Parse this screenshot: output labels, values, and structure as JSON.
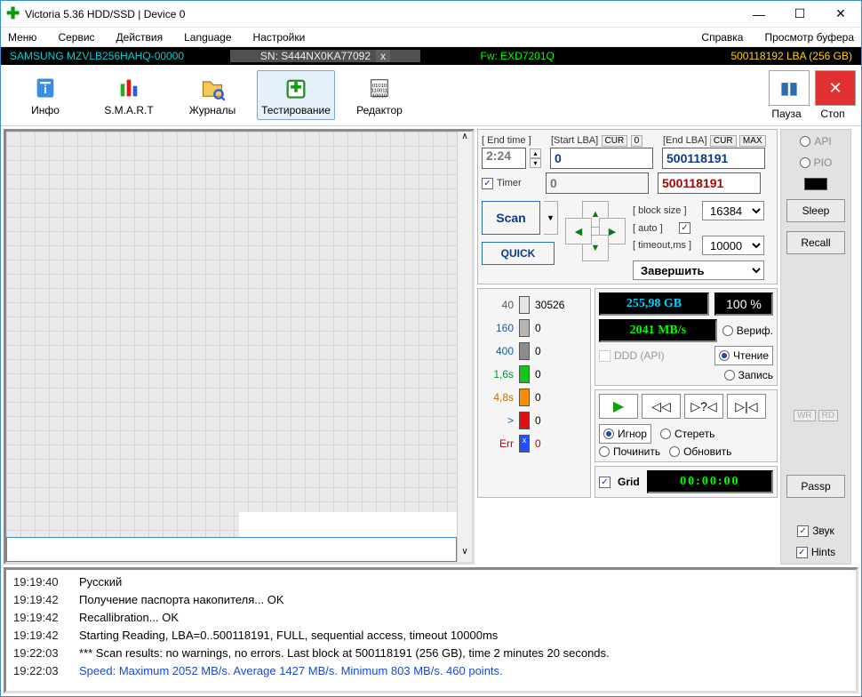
{
  "title": "Victoria 5.36 HDD/SSD | Device 0",
  "menu": {
    "m0": "Меню",
    "m1": "Сервис",
    "m2": "Действия",
    "m3": "Language",
    "m4": "Настройки",
    "m5": "Справка",
    "m6": "Просмотр буфера"
  },
  "device": {
    "model": "SAMSUNG MZVLB256HAHQ-00000",
    "sn": "SN: S444NX0KA77092",
    "fw": "Fw: EXD7201Q",
    "lba": "500118192 LBA (256 GB)"
  },
  "tools": {
    "info": "Инфо",
    "smart": "S.M.A.R.T",
    "journals": "Журналы",
    "test": "Тестирование",
    "editor": "Редактор",
    "pause": "Пауза",
    "stop": "Стоп"
  },
  "scan": {
    "endtime_lbl": "[ End time ]",
    "startlba_lbl": "[Start LBA]",
    "endlba_lbl": "[End LBA]",
    "cur": "CUR",
    "zero": "0",
    "max": "MAX",
    "endtime": "2:24",
    "startlba": "0",
    "endlba": "500118191",
    "timer_lbl": "Timer",
    "timer_start": "0",
    "timer_end": "500118191",
    "scan_btn": "Scan",
    "quick_btn": "QUICK",
    "blocksize_lbl": "[ block size ]",
    "auto_lbl": "[ auto ]",
    "timeout_lbl": "[ timeout,ms ]",
    "blocksize": "16384",
    "timeout": "10000",
    "finish_sel": "Завершить",
    "size_lcd": "255,98 GB",
    "speed_lcd": "2041 MB/s",
    "pct": "100   %",
    "verify": "Вериф.",
    "read": "Чтение",
    "write": "Запись",
    "ddd": "DDD (API)",
    "ignore": "Игнор",
    "erase": "Стереть",
    "repair": "Починить",
    "refresh": "Обновить",
    "grid": "Grid",
    "clock": "00:00:00"
  },
  "timing": {
    "t0": {
      "l": "40",
      "v": "30526",
      "c": "#e5e5e5"
    },
    "t1": {
      "l": "160",
      "v": "0",
      "c": "#b5b5b5"
    },
    "t2": {
      "l": "400",
      "v": "0",
      "c": "#8c8c8c"
    },
    "t3": {
      "l": "1,6s",
      "v": "0",
      "c": "#12c716"
    },
    "t4": {
      "l": "4,8s",
      "v": "0",
      "c": "#ff8a00"
    },
    "t5": {
      "l": ">",
      "v": "0",
      "c": "#e01010"
    },
    "t6": {
      "l": "Err",
      "v": "0",
      "c": "#2050ff"
    }
  },
  "right": {
    "api": "API",
    "pio": "PIO",
    "sleep": "Sleep",
    "recall": "Recall",
    "passp": "Passp",
    "wr": "WR",
    "rd": "RD"
  },
  "log": {
    "r0": {
      "t": "19:19:40",
      "m": "Русский"
    },
    "r1": {
      "t": "19:19:42",
      "m": "Получение паспорта накопителя... OK"
    },
    "r2": {
      "t": "19:19:42",
      "m": "Recallibration... OK"
    },
    "r3": {
      "t": "19:19:42",
      "m": "Starting Reading, LBA=0..500118191, FULL, sequential access, timeout 10000ms"
    },
    "r4": {
      "t": "19:22:03",
      "m": "*** Scan results: no warnings, no errors. Last block at 500118191 (256 GB), time 2 minutes 20 seconds."
    },
    "r5": {
      "t": "19:22:03",
      "m": "Speed: Maximum 2052 MB/s. Average 1427 MB/s. Minimum 803 MB/s. 460 points."
    }
  },
  "opts": {
    "sound": "Звук",
    "hints": "Hints"
  }
}
